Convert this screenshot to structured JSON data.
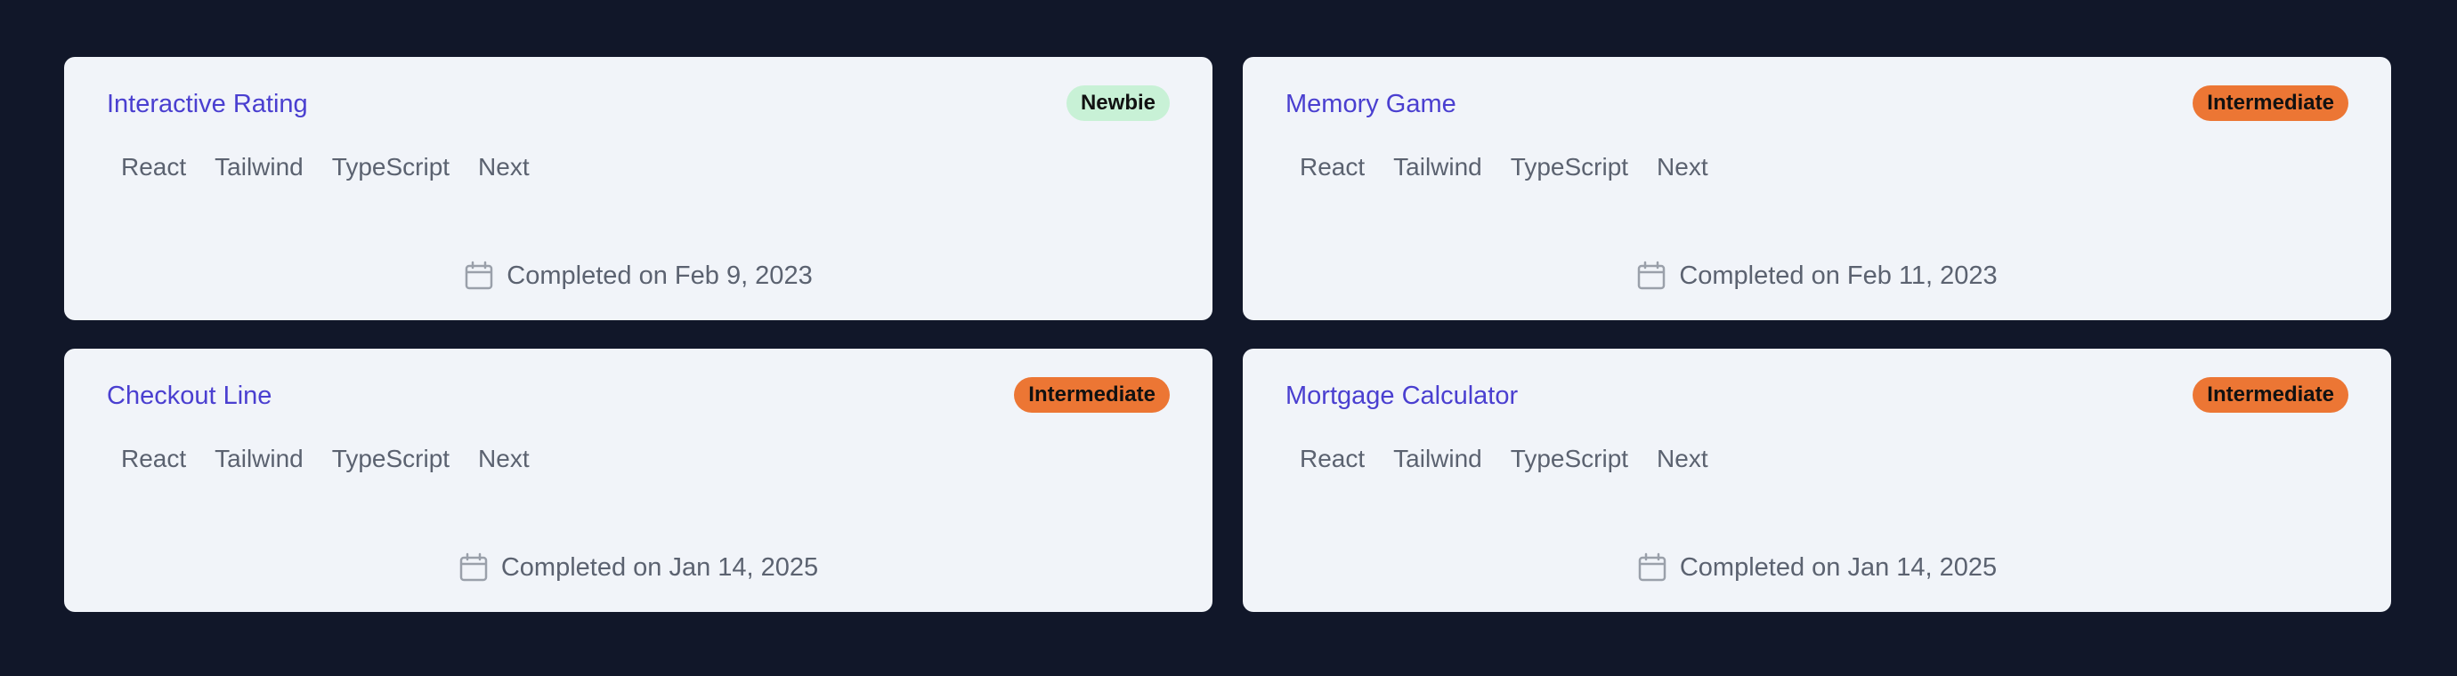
{
  "colors": {
    "background": "#111729",
    "card": "#f1f4f9",
    "title": "#4a3fd0",
    "newbie_badge": "#c8f1d6",
    "intermediate_badge": "#ec7634"
  },
  "cards": [
    {
      "title": "Interactive Rating",
      "level": "Newbie",
      "level_color": "#c8f1d6",
      "tags": [
        "React",
        "Tailwind",
        "TypeScript",
        "Next"
      ],
      "completed": "Completed on Feb 9, 2023",
      "icon": "calendar-icon"
    },
    {
      "title": "Memory Game",
      "level": "Intermediate",
      "level_color": "#ec7634",
      "tags": [
        "React",
        "Tailwind",
        "TypeScript",
        "Next"
      ],
      "completed": "Completed on Feb 11, 2023",
      "icon": "calendar-icon"
    },
    {
      "title": "Checkout Line",
      "level": "Intermediate",
      "level_color": "#ec7634",
      "tags": [
        "React",
        "Tailwind",
        "TypeScript",
        "Next"
      ],
      "completed": "Completed on Jan 14, 2025",
      "icon": "calendar-icon"
    },
    {
      "title": "Mortgage Calculator",
      "level": "Intermediate",
      "level_color": "#ec7634",
      "tags": [
        "React",
        "Tailwind",
        "TypeScript",
        "Next"
      ],
      "completed": "Completed on Jan 14, 2025",
      "icon": "calendar-icon"
    }
  ]
}
